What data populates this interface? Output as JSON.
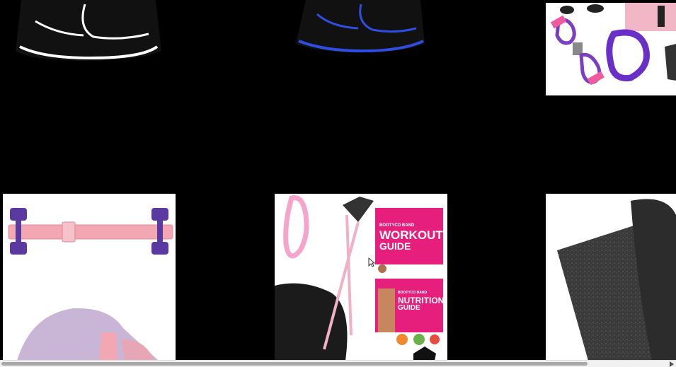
{
  "grid": {
    "tiles": [
      {
        "name": "black-white-skirt-belt",
        "bg": "#000000"
      },
      {
        "name": "black-blue-skirt-belt",
        "bg": "#000000"
      },
      {
        "name": "figure8-bands-rings",
        "bg": "#ffffff"
      },
      {
        "name": "pink-belt-dumbbells",
        "bg": "#ffffff"
      },
      {
        "name": "bootyco-workout-guide",
        "bg": "#ffffff",
        "texts": {
          "workout_line1": "BOOTYCO BAND",
          "workout_line2": "WORKOUT",
          "workout_line3": "GUIDE",
          "nutrition_line1": "BOOTYCO BAND",
          "nutrition_line2": "NUTRITION",
          "nutrition_line3": "GUIDE"
        }
      },
      {
        "name": "rolled-rubber-mat",
        "bg": "#ffffff"
      }
    ]
  },
  "colors": {
    "accent_pink": "#e61e7c",
    "band_pink": "#f2a7b3",
    "purple": "#5a3aa0",
    "blue_trim": "#2f4de0"
  },
  "scrollbar": {
    "thumb_fraction": 0.87
  }
}
